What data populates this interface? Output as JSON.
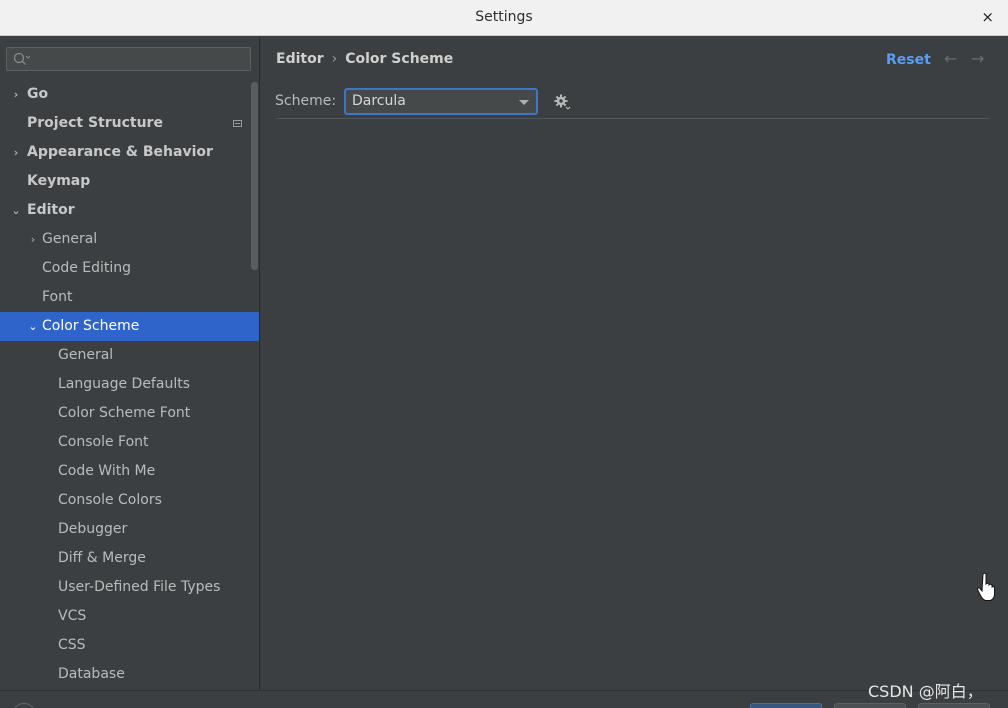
{
  "window": {
    "title": "Settings",
    "close_glyph": "×"
  },
  "search": {
    "placeholder": "",
    "icon": "search-icon"
  },
  "sidebar": {
    "items": [
      {
        "label": "Go",
        "level": 0,
        "arrow": "›",
        "bold": true
      },
      {
        "label": "Project Structure",
        "level": 0,
        "arrow": "",
        "bold": true,
        "badge": true
      },
      {
        "label": "Appearance & Behavior",
        "level": 0,
        "arrow": "›",
        "bold": true
      },
      {
        "label": "Keymap",
        "level": 0,
        "arrow": "",
        "bold": true
      },
      {
        "label": "Editor",
        "level": 0,
        "arrow": "⌄",
        "bold": true
      },
      {
        "label": "General",
        "level": 1,
        "arrow": "›"
      },
      {
        "label": "Code Editing",
        "level": 1,
        "arrow": ""
      },
      {
        "label": "Font",
        "level": 1,
        "arrow": ""
      },
      {
        "label": "Color Scheme",
        "level": 1,
        "arrow": "⌄",
        "selected": true
      },
      {
        "label": "General",
        "level": 2,
        "arrow": ""
      },
      {
        "label": "Language Defaults",
        "level": 2,
        "arrow": ""
      },
      {
        "label": "Color Scheme Font",
        "level": 2,
        "arrow": ""
      },
      {
        "label": "Console Font",
        "level": 2,
        "arrow": ""
      },
      {
        "label": "Code With Me",
        "level": 2,
        "arrow": ""
      },
      {
        "label": "Console Colors",
        "level": 2,
        "arrow": ""
      },
      {
        "label": "Debugger",
        "level": 2,
        "arrow": ""
      },
      {
        "label": "Diff & Merge",
        "level": 2,
        "arrow": ""
      },
      {
        "label": "User-Defined File Types",
        "level": 2,
        "arrow": ""
      },
      {
        "label": "VCS",
        "level": 2,
        "arrow": ""
      },
      {
        "label": "CSS",
        "level": 2,
        "arrow": ""
      },
      {
        "label": "Database",
        "level": 2,
        "arrow": ""
      }
    ]
  },
  "main": {
    "breadcrumb": {
      "parent": "Editor",
      "separator": "›",
      "current": "Color Scheme"
    },
    "reset_label": "Reset",
    "back_glyph": "←",
    "forward_glyph": "→",
    "scheme": {
      "label": "Scheme:",
      "value": "Darcula"
    }
  },
  "watermark": "CSDN @阿白，",
  "colors": {
    "accent": "#2f65ca",
    "link": "#589df6",
    "background": "#3c3f41"
  }
}
